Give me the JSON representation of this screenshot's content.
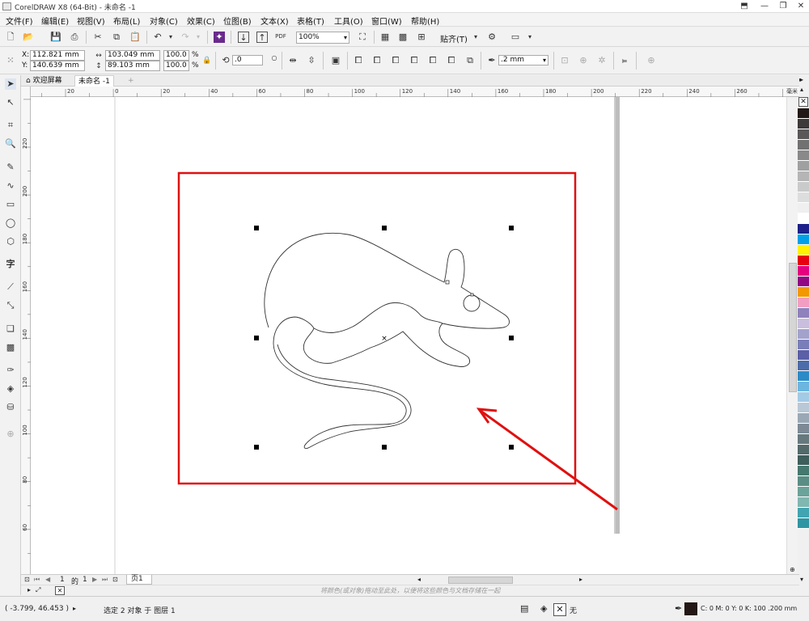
{
  "window": {
    "title": "CorelDRAW X8 (64-Bit) - 未命名 -1"
  },
  "menus": [
    "文件(F)",
    "编辑(E)",
    "视图(V)",
    "布局(L)",
    "对象(C)",
    "效果(C)",
    "位图(B)",
    "文本(X)",
    "表格(T)",
    "工具(O)",
    "窗口(W)",
    "帮助(H)"
  ],
  "standard_toolbar": {
    "zoom": "100%",
    "snap_label": "贴齐(T)",
    "pdf_label": "PDF"
  },
  "property_bar": {
    "x": "112.821 mm",
    "y": "140.639 mm",
    "width": "103.049 mm",
    "height": "89.103 mm",
    "scale_w": "100.0",
    "scale_h": "100.0",
    "percent": "%",
    "x_label": "X:",
    "y_label": "Y:",
    "rotation": ".0",
    "outline_width": ".2 mm"
  },
  "tabs": [
    {
      "label": "欢迎屏幕"
    },
    {
      "label": "未命名 -1"
    }
  ],
  "ruler_unit": "毫米",
  "hruler_ticks": [
    {
      "label": "20"
    },
    {
      "label": "0"
    },
    {
      "label": "20"
    },
    {
      "label": "40"
    },
    {
      "label": "60"
    },
    {
      "label": "80"
    },
    {
      "label": "100"
    },
    {
      "label": "120"
    },
    {
      "label": "140"
    },
    {
      "label": "160"
    },
    {
      "label": "180"
    },
    {
      "label": "200"
    },
    {
      "label": "220"
    },
    {
      "label": "240"
    },
    {
      "label": "260"
    }
  ],
  "vruler_ticks": [
    {
      "label": "220"
    },
    {
      "label": "200"
    },
    {
      "label": "180"
    },
    {
      "label": "160"
    },
    {
      "label": "140"
    },
    {
      "label": "120"
    },
    {
      "label": "100"
    },
    {
      "label": "80"
    },
    {
      "label": "60"
    }
  ],
  "pages": {
    "current": "1",
    "of": "的",
    "total": "1",
    "page_tab": "页1"
  },
  "hint_text": "将颜色(或对象)拖动至此处，以便将这些颜色与文档存储在一起",
  "status": {
    "cursor": "( -3.799, 46.453 )",
    "selection": "选定 2 对象 于 图层 1",
    "fill": "无",
    "outline": "C: 0 M: 0 Y: 0 K: 100  .200 mm"
  },
  "colors": {
    "accent_red": "#e01010",
    "selection_handle": "#000000"
  },
  "palette": [
    "#231815",
    "#3e3a39",
    "#595757",
    "#727171",
    "#898989",
    "#9fa0a0",
    "#b5b5b6",
    "#c9caca",
    "#dcdddd",
    "#efefef",
    "#ffffff",
    "#1d2088",
    "#00a0e9",
    "#fff100",
    "#e60012",
    "#e4007f",
    "#920783",
    "#f39800",
    "#f19ec2",
    "#8f82bc",
    "#c9bedd",
    "#a3a2cd",
    "#7a7eb8",
    "#5a5fa6",
    "#4b6ca8",
    "#2c8bc7",
    "#6bb5df",
    "#a2cbe6",
    "#b8c8d6",
    "#9aa8b5",
    "#7d8a96",
    "#667a7e",
    "#536a6b",
    "#3e5e5c",
    "#45786e",
    "#5a8e84",
    "#6aa39a",
    "#80b7b0",
    "#42a4b0",
    "#2f95a3"
  ]
}
